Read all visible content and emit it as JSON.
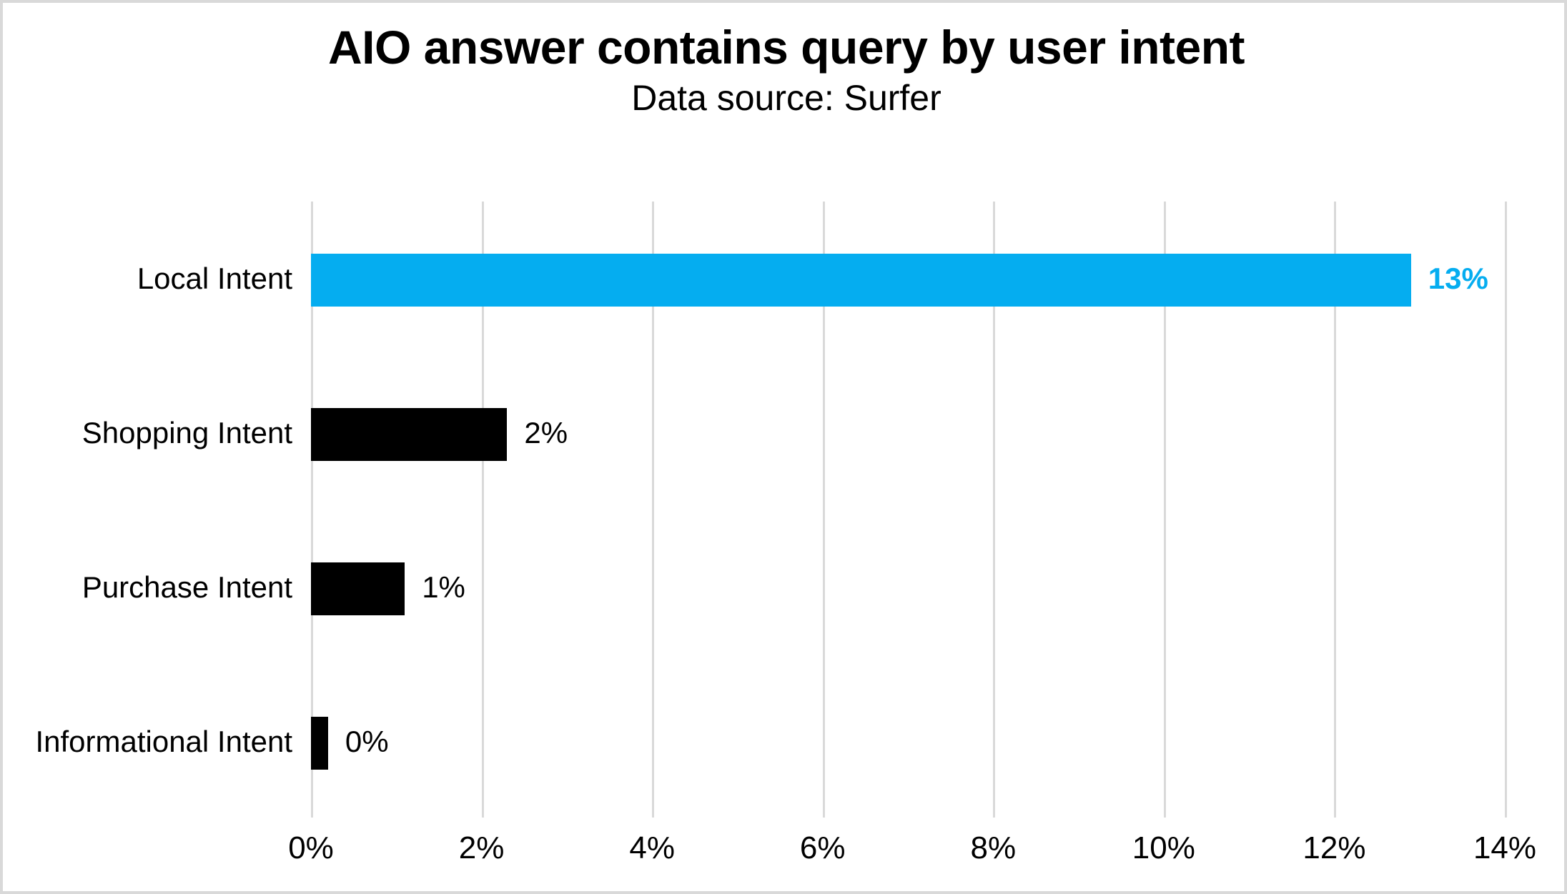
{
  "chart_data": {
    "type": "bar",
    "orientation": "horizontal",
    "title": "AIO answer contains query by user intent",
    "subtitle": "Data source: Surfer",
    "xlabel": "",
    "ylabel": "",
    "categories": [
      "Local Intent",
      "Shopping Intent",
      "Purchase Intent",
      "Informational Intent"
    ],
    "values": [
      12.9,
      2.3,
      1.1,
      0.2
    ],
    "value_labels": [
      "13%",
      "2%",
      "1%",
      "0%"
    ],
    "series": [
      {
        "name": "AIO answer contains query",
        "values": [
          12.9,
          2.3,
          1.1,
          0.2
        ]
      }
    ],
    "bar_colors": [
      "#05ADF0",
      "#000000",
      "#000000",
      "#000000"
    ],
    "highlight_category": "Local Intent",
    "xlim": [
      0,
      14
    ],
    "xticks": [
      0,
      2,
      4,
      6,
      8,
      10,
      12,
      14
    ],
    "xtick_labels": [
      "0%",
      "2%",
      "4%",
      "6%",
      "8%",
      "10%",
      "12%",
      "14%"
    ],
    "grid": {
      "vertical": true,
      "horizontal": false,
      "color": "#d9d9d9"
    },
    "legend": {
      "show": false,
      "position": "none"
    },
    "accent_color": "#05ADF0",
    "bar_color": "#000000",
    "background_color": "#ffffff",
    "border_color": "#d9d9d9"
  },
  "rows": [
    {
      "category": "Local Intent",
      "value_label": "13%",
      "value": 12.9,
      "color": "#05ADF0",
      "highlighted": true
    },
    {
      "category": "Shopping Intent",
      "value_label": "2%",
      "value": 2.3,
      "color": "#000000",
      "highlighted": false
    },
    {
      "category": "Purchase Intent",
      "value_label": "1%",
      "value": 1.1,
      "color": "#000000",
      "highlighted": false
    },
    {
      "category": "Informational Intent",
      "value_label": "0%",
      "value": 0.2,
      "color": "#000000",
      "highlighted": false
    }
  ],
  "axis": {
    "ticks": [
      {
        "label": "0%",
        "value": 0
      },
      {
        "label": "2%",
        "value": 2
      },
      {
        "label": "4%",
        "value": 4
      },
      {
        "label": "6%",
        "value": 6
      },
      {
        "label": "8%",
        "value": 8
      },
      {
        "label": "10%",
        "value": 10
      },
      {
        "label": "12%",
        "value": 12
      },
      {
        "label": "14%",
        "value": 14
      }
    ]
  }
}
